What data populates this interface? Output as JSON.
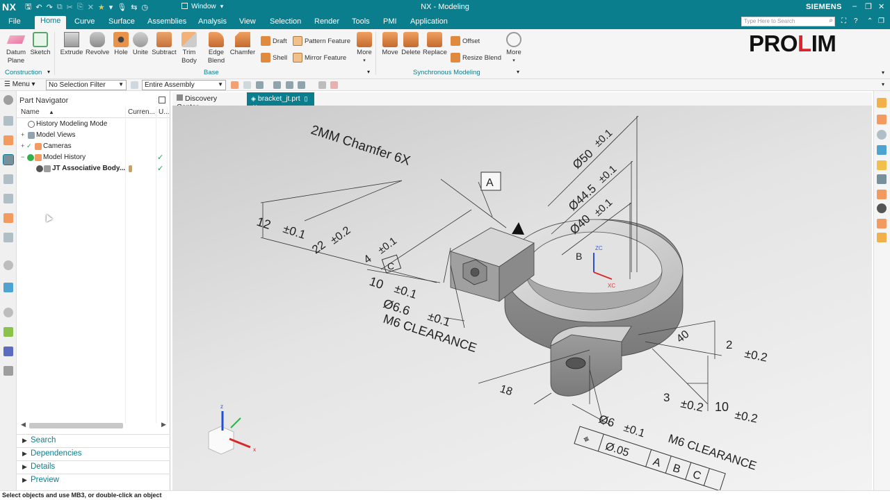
{
  "titlebar": {
    "app_logo": "NX",
    "window_label": "Window",
    "title": "NX - Modeling",
    "brand": "SIEMENS"
  },
  "tabs": [
    "File",
    "Home",
    "Curve",
    "Surface",
    "Assemblies",
    "Analysis",
    "View",
    "Selection",
    "Render",
    "Tools",
    "PMI",
    "Application"
  ],
  "active_tab": "Home",
  "search": {
    "placeholder": "Type Here to Search"
  },
  "ribbon": {
    "datum_plane": "Datum Plane",
    "sketch": "Sketch",
    "extrude": "Extrude",
    "revolve": "Revolve",
    "hole": "Hole",
    "unite": "Unite",
    "subtract": "Subtract",
    "trim_body": "Trim Body",
    "edge_blend": "Edge Blend",
    "chamfer": "Chamfer",
    "draft": "Draft",
    "shell": "Shell",
    "pattern_feature": "Pattern Feature",
    "mirror_feature": "Mirror Feature",
    "more_base": "More",
    "move": "Move",
    "delete": "Delete",
    "replace": "Replace",
    "offset": "Offset",
    "resize_blend": "Resize Blend",
    "more_sync": "More",
    "group_construction": "Construction",
    "group_base": "Base",
    "group_sync": "Synchronous Modeling",
    "logo_text_1": "PRO",
    "logo_text_2": "L",
    "logo_text_3": "IM"
  },
  "selection_bar": {
    "menu": "Menu",
    "filter": "No Selection Filter",
    "scope": "Entire Assembly"
  },
  "navigator": {
    "title": "Part Navigator",
    "col_name": "Name",
    "col_current": "Curren...",
    "col_u": "U...",
    "rows": [
      {
        "label": "History Modeling Mode",
        "bold": false
      },
      {
        "label": "Model Views",
        "bold": false
      },
      {
        "label": "Cameras",
        "bold": false
      },
      {
        "label": "Model History",
        "bold": false
      },
      {
        "label": "JT Associative Body...",
        "bold": true
      }
    ],
    "sections": [
      "Search",
      "Dependencies",
      "Details",
      "Preview"
    ]
  },
  "doc_tabs": {
    "discovery": "Discovery Center",
    "part": "bracket_jt.prt"
  },
  "drawing": {
    "chamfer_note": "2MM Chamfer 6X",
    "datum_a": "A",
    "datum_b": "B",
    "datum_c": "C",
    "d12": "12",
    "d12_tol": "±0.1",
    "d22": "22",
    "d22_tol": "±0.2",
    "d4": "4",
    "d4_tol": "±0.1",
    "d10": "10",
    "d10_tol": "±0.1",
    "hole_dia": "Ø6.6",
    "hole_tol": "±0.1",
    "hole_note": "M6 CLEARANCE",
    "d18": "18",
    "dia50": "Ø50",
    "dia50_tol": "±0.1",
    "dia44": "Ø44.5",
    "dia44_tol": "±0.1",
    "dia40": "Ø40",
    "dia40_tol": "±0.1",
    "d40": "40",
    "d2": "2",
    "d2_tol": "±0.2",
    "d3": "3",
    "d3_tol": "±0.2",
    "d10b": "10",
    "d10b_tol": "±0.2",
    "hole2_dia": "Ø6",
    "hole2_tol": "±0.1",
    "hole2_note": "M6 CLEARANCE",
    "fcf_symbol": "⌖",
    "fcf_tol": "Ø.05",
    "fcf_a": "A",
    "fcf_b": "B",
    "fcf_c": "C",
    "axis_zc": "ZC",
    "axis_xc": "XC",
    "triad_z": "z",
    "triad_x": "x"
  },
  "status": "Select objects and use MB3, or double-click an object",
  "colors": {
    "teal": "#0b7e8e",
    "check_green": "#1aa34a",
    "logo_red": "#e0202a"
  }
}
